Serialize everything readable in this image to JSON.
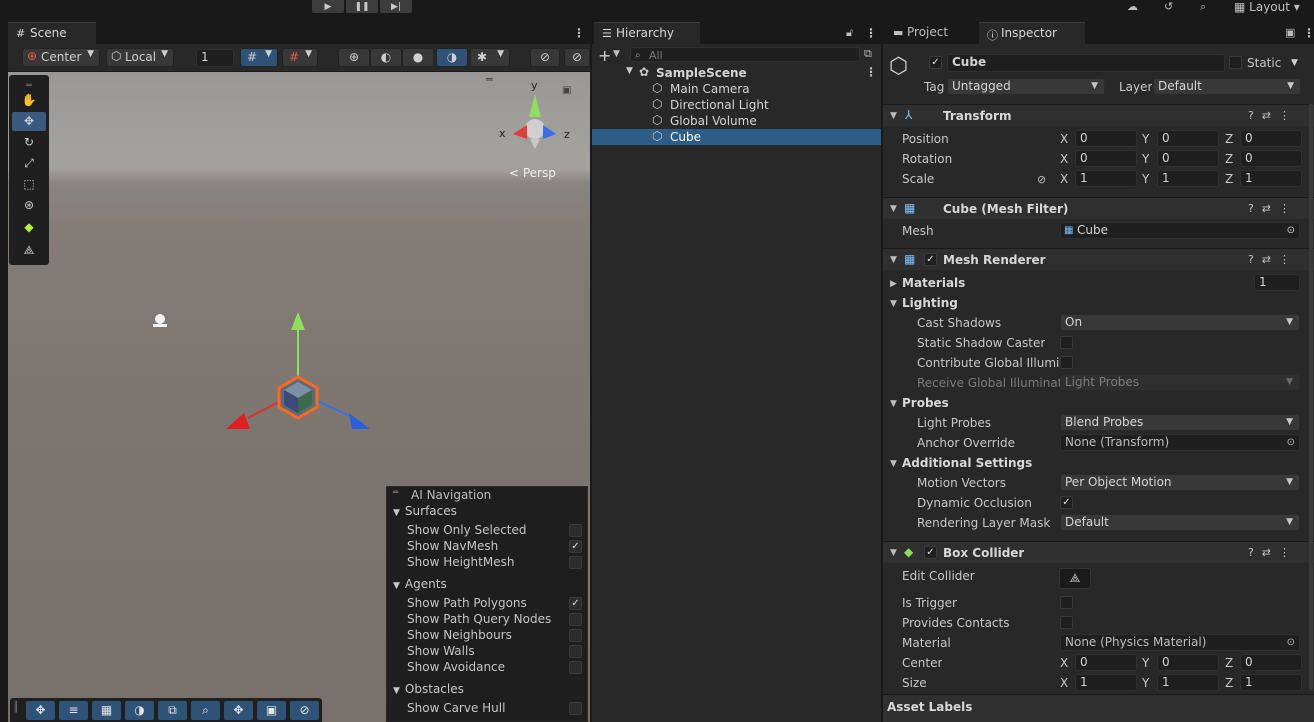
{
  "toolbar": {
    "play": "▶",
    "pause": "❚❚",
    "step": "▶|",
    "layout": "Layout"
  },
  "scene": {
    "tab": "Scene",
    "pivot": "Center",
    "space": "Local",
    "grid_value": "1",
    "persp": "< Persp",
    "gizmo_axes": {
      "x": "x",
      "y": "y",
      "z": "z"
    }
  },
  "ai_nav": {
    "title": "AI Navigation",
    "sections": [
      {
        "title": "Surfaces",
        "items": [
          {
            "label": "Show Only Selected",
            "checked": false
          },
          {
            "label": "Show NavMesh",
            "checked": true
          },
          {
            "label": "Show HeightMesh",
            "checked": false
          }
        ]
      },
      {
        "title": "Agents",
        "items": [
          {
            "label": "Show Path Polygons",
            "checked": true
          },
          {
            "label": "Show Path Query Nodes",
            "checked": false
          },
          {
            "label": "Show Neighbours",
            "checked": false
          },
          {
            "label": "Show Walls",
            "checked": false
          },
          {
            "label": "Show Avoidance",
            "checked": false
          }
        ]
      },
      {
        "title": "Obstacles",
        "items": [
          {
            "label": "Show Carve Hull",
            "checked": false
          }
        ]
      }
    ]
  },
  "hierarchy": {
    "tab": "Hierarchy",
    "search_placeholder": "All",
    "scene": "SampleScene",
    "items": [
      "Main Camera",
      "Directional Light",
      "Global Volume",
      "Cube"
    ],
    "selected": "Cube"
  },
  "inspector": {
    "tabs": {
      "project": "Project",
      "inspector": "Inspector"
    },
    "object_name": "Cube",
    "static_label": "Static",
    "tag_label": "Tag",
    "tag_value": "Untagged",
    "layer_label": "Layer",
    "layer_value": "Default",
    "transform": {
      "title": "Transform",
      "rows": [
        {
          "label": "Position",
          "x": "0",
          "y": "0",
          "z": "0"
        },
        {
          "label": "Rotation",
          "x": "0",
          "y": "0",
          "z": "0"
        },
        {
          "label": "Scale",
          "x": "1",
          "y": "1",
          "z": "1"
        }
      ]
    },
    "mesh_filter": {
      "title": "Cube (Mesh Filter)",
      "mesh_label": "Mesh",
      "mesh_value": "Cube"
    },
    "mesh_renderer": {
      "title": "Mesh Renderer",
      "materials": "Materials",
      "materials_count": "1",
      "lighting": "Lighting",
      "cast_shadows": "Cast Shadows",
      "cast_shadows_value": "On",
      "static_shadow_caster": "Static Shadow Caster",
      "contribute_gi": "Contribute Global Illumina",
      "receive_gi": "Receive Global Illuminatic",
      "receive_gi_value": "Light Probes",
      "probes": "Probes",
      "light_probes": "Light Probes",
      "light_probes_value": "Blend Probes",
      "anchor_override": "Anchor Override",
      "anchor_override_value": "None (Transform)",
      "additional": "Additional Settings",
      "motion_vectors": "Motion Vectors",
      "motion_vectors_value": "Per Object Motion",
      "dynamic_occlusion": "Dynamic Occlusion",
      "rendering_layer_mask": "Rendering Layer Mask",
      "rendering_layer_mask_value": "Default"
    },
    "box_collider": {
      "title": "Box Collider",
      "edit_collider": "Edit Collider",
      "is_trigger": "Is Trigger",
      "provides_contacts": "Provides Contacts",
      "material": "Material",
      "material_value": "None (Physics Material)",
      "center": {
        "label": "Center",
        "x": "0",
        "y": "0",
        "z": "0"
      },
      "size": {
        "label": "Size",
        "x": "1",
        "y": "1",
        "z": "1"
      }
    },
    "asset_labels": "Asset Labels"
  }
}
